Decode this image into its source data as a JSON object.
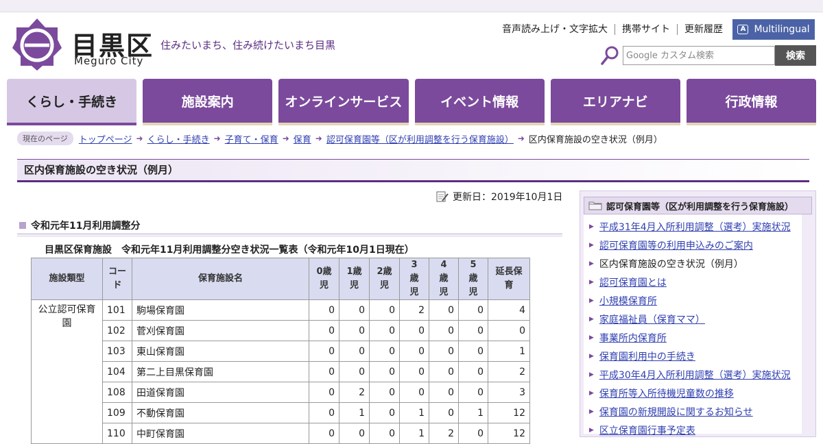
{
  "header": {
    "logo_name": "目黒区",
    "logo_sub": "Meguro City",
    "tagline": "住みたいまち、住み続けたいまち目黒",
    "top_links": [
      "音声読み上げ・文字拡大",
      "携帯サイト",
      "更新履歴"
    ],
    "multilingual": "Multilingual",
    "search_placeholder": "Google カスタム検索",
    "search_button": "検索"
  },
  "nav": {
    "tabs": [
      "くらし・手続き",
      "施設案内",
      "オンラインサービス",
      "イベント情報",
      "エリアナビ",
      "行政情報"
    ]
  },
  "breadcrumb": {
    "here_label": "現在のページ",
    "items": [
      "トップページ",
      "くらし・手続き",
      "子育て・保育",
      "保育",
      "認可保育園等（区が利用調整を行う保育施設）"
    ],
    "current": "区内保育施設の空き状況（例月）"
  },
  "page": {
    "title": "区内保育施設の空き状況（例月）",
    "updated": "更新日：2019年10月1日",
    "section_heading": "令和元年11月利用調整分",
    "table_caption": "目黒区保育施設　令和元年11月利用調整分空き状況一覧表（令和元年10月1日現在）"
  },
  "table": {
    "headers": [
      "施設類型",
      "コード",
      "保育施設名",
      "0歳児",
      "1歳児",
      "2歳児",
      "3歳児",
      "4歳児",
      "5歳児",
      "延長保育"
    ],
    "type_label": "公立認可保育園",
    "rows": [
      {
        "code": "101",
        "name": "駒場保育園",
        "v": [
          "0",
          "0",
          "0",
          "2",
          "0",
          "0",
          "4"
        ]
      },
      {
        "code": "102",
        "name": "菅刈保育園",
        "v": [
          "0",
          "0",
          "0",
          "0",
          "0",
          "0",
          "0"
        ]
      },
      {
        "code": "103",
        "name": "東山保育園",
        "v": [
          "0",
          "0",
          "0",
          "0",
          "0",
          "0",
          "1"
        ]
      },
      {
        "code": "104",
        "name": "第二上目黒保育園",
        "v": [
          "0",
          "0",
          "0",
          "0",
          "0",
          "0",
          "2"
        ]
      },
      {
        "code": "108",
        "name": "田道保育園",
        "v": [
          "0",
          "2",
          "0",
          "0",
          "0",
          "0",
          "3"
        ]
      },
      {
        "code": "109",
        "name": "不動保育園",
        "v": [
          "0",
          "1",
          "0",
          "1",
          "0",
          "1",
          "12"
        ]
      },
      {
        "code": "110",
        "name": "中町保育園",
        "v": [
          "0",
          "0",
          "0",
          "1",
          "2",
          "0",
          "12"
        ]
      }
    ]
  },
  "sidebar": {
    "heading": "認可保育園等（区が利用調整を行う保育施設）",
    "items": [
      {
        "label": "平成31年4月入所利用調整（選考）実施状況",
        "current": false
      },
      {
        "label": "認可保育園等の利用申込みのご案内",
        "current": false
      },
      {
        "label": "区内保育施設の空き状況（例月）",
        "current": true
      },
      {
        "label": "認可保育園とは",
        "current": false
      },
      {
        "label": "小規模保育所",
        "current": false
      },
      {
        "label": "家庭福祉員（保育ママ）",
        "current": false
      },
      {
        "label": "事業所内保育所",
        "current": false
      },
      {
        "label": "保育園利用中の手続き",
        "current": false
      },
      {
        "label": "平成30年4月入所利用調整（選考）実施状況",
        "current": false
      },
      {
        "label": "保育所等入所待機児童数の推移",
        "current": false
      },
      {
        "label": "保育園の新規開設に関するお知らせ",
        "current": false
      },
      {
        "label": "区立保育園行事予定表",
        "current": false
      }
    ]
  }
}
